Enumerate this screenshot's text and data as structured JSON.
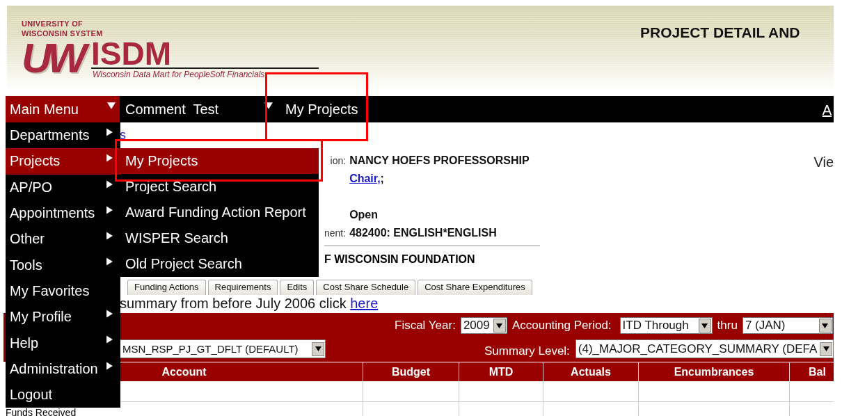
{
  "header": {
    "logo": {
      "line_1": "UNIVERSITY OF",
      "line_2": "WISCONSIN SYSTEM",
      "mark": "UW",
      "name": "ISDM",
      "tagline": "Wisconsin Data Mart for PeopleSoft Financials"
    },
    "title": "PROJECT DETAIL AND"
  },
  "nav": {
    "items": [
      {
        "label": "Main Menu",
        "selected": true,
        "dropdown": true
      },
      {
        "label": "Comment  Test",
        "selected": false,
        "dropdown": true
      },
      {
        "label": "My Projects",
        "selected": false,
        "dropdown": false
      }
    ],
    "right_link": "A"
  },
  "breadcrumb_link": "s",
  "project_info": {
    "rows": [
      {
        "kind": "field",
        "label": "ion:",
        "value": "NANCY HOEFS PROFESSORSHIP"
      },
      {
        "kind": "link",
        "link": "Chair,",
        "value": ";"
      },
      {
        "kind": "blank"
      },
      {
        "kind": "field",
        "value": "Open"
      },
      {
        "kind": "field",
        "label": "nent:",
        "value": "482400: ENGLISH*ENGLISH"
      }
    ],
    "sponsor": "F WISCONSIN FOUNDATION"
  },
  "view_link": "Vie",
  "tabs": [
    {
      "label": "Funding Actions",
      "selected": false
    },
    {
      "label": "Requirements",
      "selected": false
    },
    {
      "label": "Edits",
      "selected": false
    },
    {
      "label": "Cost Share Schedule",
      "selected": false
    },
    {
      "label": "Cost Share Expenditures",
      "selected": false
    }
  ],
  "note": {
    "text": "summary from before July 2006 click ",
    "link": "here"
  },
  "filters": {
    "fiscal_year": {
      "label": "Fiscal Year:",
      "value": "2009"
    },
    "accounting_period": {
      "label": "Accounting Period:",
      "value": "ITD Through"
    },
    "thru": {
      "label": "thru",
      "value": "7 (JAN)"
    },
    "tree": {
      "value": "MSN_RSP_PJ_GT_DFLT (DEFAULT)"
    },
    "summary_level": {
      "label": "Summary Level:",
      "value": "(4)_MAJOR_CATEGORY_SUMMARY (DEFA"
    }
  },
  "table": {
    "columns": [
      "Account",
      "Budget",
      "MTD",
      "Actuals",
      "Encumbrances",
      "Bal"
    ],
    "rows": [
      {
        "kind": "blank"
      },
      {
        "kind": "data",
        "account": "Funds Received"
      }
    ]
  },
  "main_menu": {
    "items": [
      {
        "label": "Departments",
        "selected": false,
        "submenu": true
      },
      {
        "label": "Projects",
        "selected": true,
        "submenu": true
      },
      {
        "label": "AP/PO",
        "selected": false,
        "submenu": true
      },
      {
        "label": "Appointments",
        "selected": false,
        "submenu": true
      },
      {
        "label": "Other",
        "selected": false,
        "submenu": true
      },
      {
        "label": "Tools",
        "selected": false,
        "submenu": true
      },
      {
        "label": "My Favorites",
        "selected": false,
        "submenu": false
      },
      {
        "label": "My Profile",
        "selected": false,
        "submenu": true
      },
      {
        "label": "Help",
        "selected": false,
        "submenu": true
      },
      {
        "label": "Administration",
        "selected": false,
        "submenu": true
      },
      {
        "label": "Logout",
        "selected": false,
        "submenu": false
      }
    ]
  },
  "submenu": {
    "items": [
      {
        "label": "My Projects",
        "selected": true
      },
      {
        "label": "Project Search",
        "selected": false
      },
      {
        "label": "Award Funding Action Report",
        "selected": false
      },
      {
        "label": "WISPER Search",
        "selected": false
      },
      {
        "label": "Old Project Search",
        "selected": false
      }
    ]
  },
  "annotations": [
    {
      "kind": "box"
    },
    {
      "kind": "box"
    }
  ]
}
